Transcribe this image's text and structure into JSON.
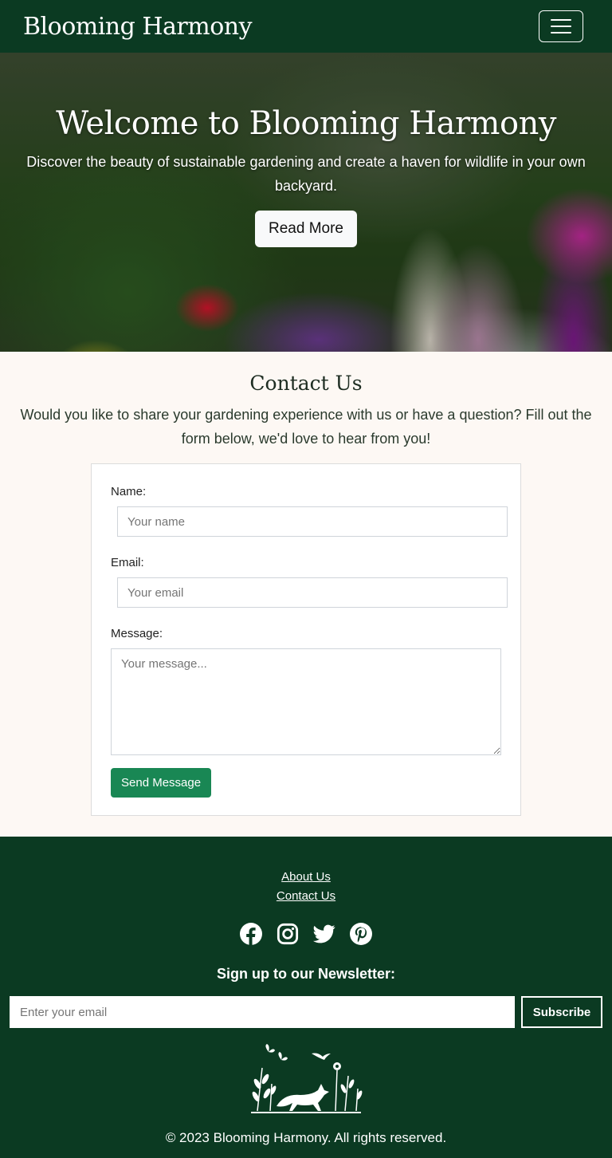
{
  "navbar": {
    "brand": "Blooming Harmony",
    "menu_icon": "hamburger-menu-icon"
  },
  "hero": {
    "title": "Welcome to Blooming Harmony",
    "subtitle": "Discover the beauty of sustainable gardening and create a haven for wildlife in your own backyard.",
    "button_label": "Read More"
  },
  "contact": {
    "title": "Contact Us",
    "intro": "Would you like to share your gardening experience with us or have a question? Fill out the form below, we'd love to hear from you!",
    "form": {
      "name_label": "Name:",
      "name_placeholder": "Your name",
      "email_label": "Email:",
      "email_placeholder": "Your email",
      "message_label": "Message:",
      "message_placeholder": "Your message...",
      "submit_label": "Send Message"
    }
  },
  "footer": {
    "links": [
      "About Us",
      "Contact Us"
    ],
    "social_icons": [
      "facebook-icon",
      "instagram-icon",
      "twitter-icon",
      "pinterest-icon"
    ],
    "newsletter_heading": "Sign up to our Newsletter:",
    "newsletter_placeholder": "Enter your email",
    "subscribe_label": "Subscribe",
    "copyright": "© 2023 Blooming Harmony. All rights reserved."
  },
  "colors": {
    "primary_dark_green": "#0b3a22",
    "button_green": "#198754",
    "background_cream": "#fdf8f4"
  }
}
